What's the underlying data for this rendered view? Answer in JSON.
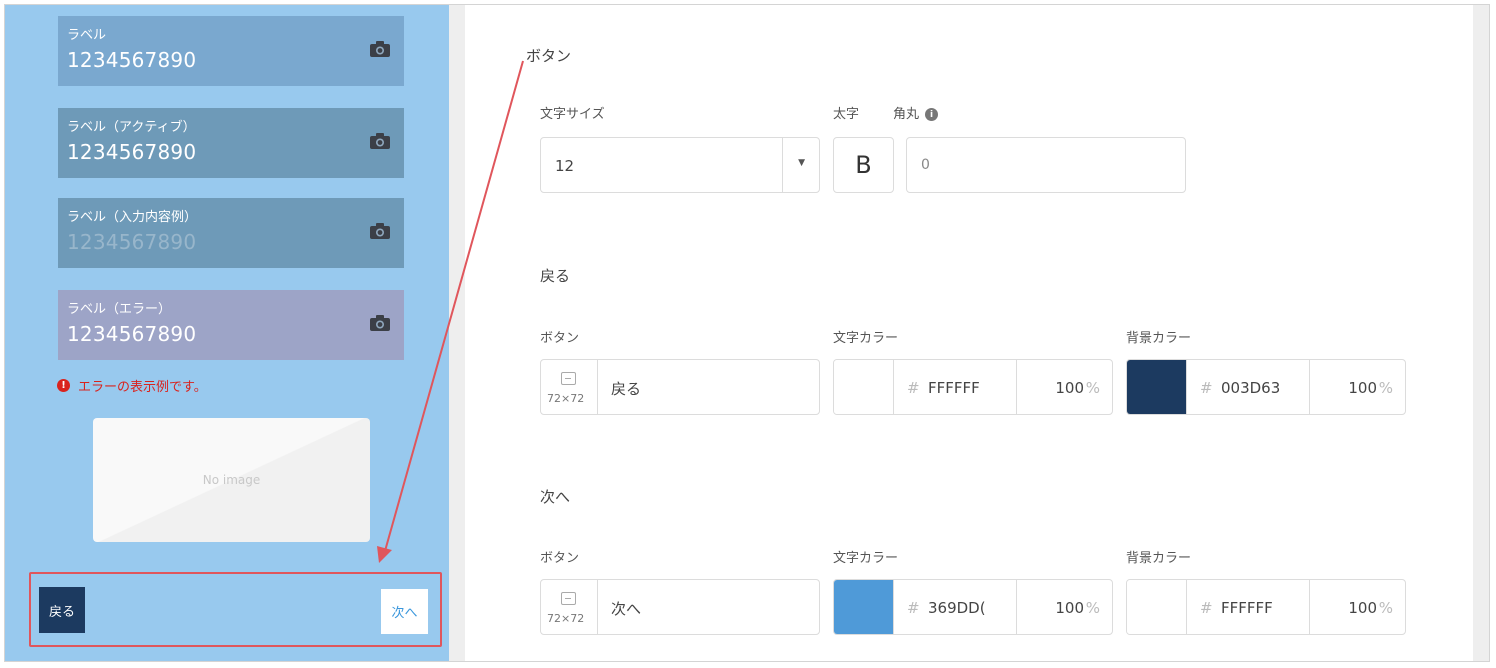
{
  "preview": {
    "fields": [
      {
        "label": "ラベル",
        "value": "1234567890"
      },
      {
        "label": "ラベル（アクティブ）",
        "value": "1234567890"
      },
      {
        "label": "ラベル（入力内容例）",
        "value": "1234567890"
      },
      {
        "label": "ラベル（エラー）",
        "value": "1234567890"
      }
    ],
    "error_icon": "!",
    "error_text": "エラーの表示例です。",
    "no_image": "No image",
    "back_label": "戻る",
    "next_label": "次へ"
  },
  "settings": {
    "button_section": {
      "title": "ボタン",
      "font_size_label": "文字サイズ",
      "font_size_value": "12",
      "bold_label": "太字",
      "bold_glyph": "B",
      "radius_label": "角丸",
      "info_glyph": "i",
      "radius_value": "0"
    },
    "back_section": {
      "title": "戻る",
      "button_label": "ボタン",
      "image_size": "72×72",
      "button_text": "戻る",
      "text_color_label": "文字カラー",
      "text_color_hex": "FFFFFF",
      "text_color_swatch": "#ffffff",
      "text_color_opacity": "100",
      "bg_color_label": "背景カラー",
      "bg_color_hex": "003D63",
      "bg_color_swatch": "#1c3a60",
      "bg_color_opacity": "100"
    },
    "next_section": {
      "title": "次へ",
      "button_label": "ボタン",
      "image_size": "72×72",
      "button_text": "次へ",
      "text_color_label": "文字カラー",
      "text_color_hex": "369DD(",
      "text_color_swatch": "#4f9ad8",
      "text_color_opacity": "100",
      "bg_color_label": "背景カラー",
      "bg_color_hex": "FFFFFF",
      "bg_color_swatch": "#ffffff",
      "bg_color_opacity": "100"
    },
    "hash_symbol": "#",
    "percent_symbol": "%"
  },
  "colors": {
    "preview_bg": "#98c9ee",
    "highlight": "#e0565c",
    "error": "#d9231e"
  }
}
